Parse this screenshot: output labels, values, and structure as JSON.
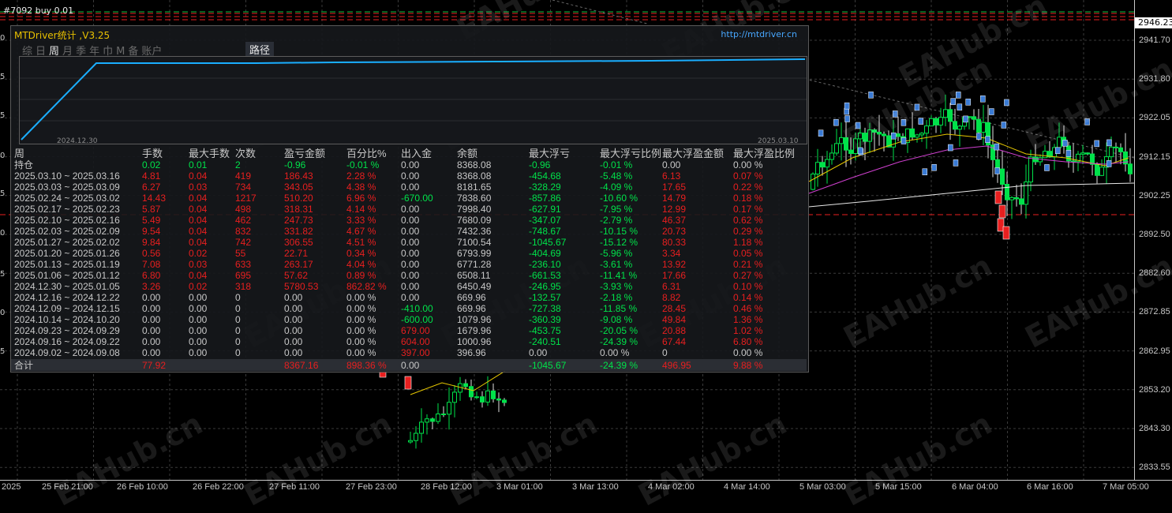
{
  "top_info": "#7092 buy 0.01",
  "panel": {
    "title": "MTDriver统计 ,V3.25",
    "url": "http://mtdriver.cn",
    "tabs": [
      "综",
      "日",
      "周",
      "月",
      "季",
      "年",
      "巾",
      "M",
      "备",
      "账户"
    ],
    "active_tab": "周",
    "path_button": "路径",
    "eq_dates": [
      "2024.12.30",
      "2025.03.10"
    ],
    "headers": [
      "周",
      "手数",
      "最大手数",
      "次数",
      "盈亏金额",
      "百分比%",
      "出入金",
      "余额",
      "最大浮亏",
      "最大浮亏比例",
      "最大浮盈金额",
      "最大浮盈比例"
    ],
    "rows": [
      {
        "c": [
          "持仓",
          "0.02",
          "0.01",
          "2",
          "-0.96",
          "-0.01 %",
          "0.00",
          "8368.08",
          "-0.96",
          "-0.01 %",
          "0.00",
          "0.00 %"
        ],
        "k": [
          "w",
          "g",
          "g",
          "g",
          "g",
          "g",
          "w",
          "w",
          "g",
          "g",
          "w",
          "w"
        ]
      },
      {
        "c": [
          "2025.03.10 ~ 2025.03.16",
          "4.81",
          "0.04",
          "419",
          "186.43",
          "2.28 %",
          "0.00",
          "8368.08",
          "-454.68",
          "-5.48 %",
          "6.13",
          "0.07 %"
        ],
        "k": [
          "w",
          "r",
          "r",
          "r",
          "r",
          "r",
          "w",
          "w",
          "g",
          "g",
          "r",
          "r"
        ]
      },
      {
        "c": [
          "2025.03.03 ~ 2025.03.09",
          "6.27",
          "0.03",
          "734",
          "343.05",
          "4.38 %",
          "0.00",
          "8181.65",
          "-328.29",
          "-4.09 %",
          "17.65",
          "0.22 %"
        ],
        "k": [
          "w",
          "r",
          "r",
          "r",
          "r",
          "r",
          "w",
          "w",
          "g",
          "g",
          "r",
          "r"
        ]
      },
      {
        "c": [
          "2025.02.24 ~ 2025.03.02",
          "14.43",
          "0.04",
          "1217",
          "510.20",
          "6.96 %",
          "-670.00",
          "7838.60",
          "-857.86",
          "-10.60 %",
          "14.79",
          "0.18 %"
        ],
        "k": [
          "w",
          "r",
          "r",
          "r",
          "r",
          "r",
          "g",
          "w",
          "g",
          "g",
          "r",
          "r"
        ]
      },
      {
        "c": [
          "2025.02.17 ~ 2025.02.23",
          "5.87",
          "0.04",
          "498",
          "318.31",
          "4.14 %",
          "0.00",
          "7998.40",
          "-627.91",
          "-7.95 %",
          "12.99",
          "0.17 %"
        ],
        "k": [
          "w",
          "r",
          "r",
          "r",
          "r",
          "r",
          "w",
          "w",
          "g",
          "g",
          "r",
          "r"
        ]
      },
      {
        "c": [
          "2025.02.10 ~ 2025.02.16",
          "5.49",
          "0.04",
          "462",
          "247.73",
          "3.33 %",
          "0.00",
          "7680.09",
          "-347.07",
          "-2.79 %",
          "46.37",
          "0.62 %"
        ],
        "k": [
          "w",
          "r",
          "r",
          "r",
          "r",
          "r",
          "w",
          "w",
          "g",
          "g",
          "r",
          "r"
        ]
      },
      {
        "c": [
          "2025.02.03 ~ 2025.02.09",
          "9.54",
          "0.04",
          "832",
          "331.82",
          "4.67 %",
          "0.00",
          "7432.36",
          "-748.67",
          "-10.15 %",
          "20.73",
          "0.29 %"
        ],
        "k": [
          "w",
          "r",
          "r",
          "r",
          "r",
          "r",
          "w",
          "w",
          "g",
          "g",
          "r",
          "r"
        ]
      },
      {
        "c": [
          "2025.01.27 ~ 2025.02.02",
          "9.84",
          "0.04",
          "742",
          "306.55",
          "4.51 %",
          "0.00",
          "7100.54",
          "-1045.67",
          "-15.12 %",
          "80.33",
          "1.18 %"
        ],
        "k": [
          "w",
          "r",
          "r",
          "r",
          "r",
          "r",
          "w",
          "w",
          "g",
          "g",
          "r",
          "r"
        ]
      },
      {
        "c": [
          "2025.01.20 ~ 2025.01.26",
          "0.56",
          "0.02",
          "55",
          "22.71",
          "0.34 %",
          "0.00",
          "6793.99",
          "-404.69",
          "-5.96 %",
          "3.34",
          "0.05 %"
        ],
        "k": [
          "w",
          "r",
          "r",
          "r",
          "r",
          "r",
          "w",
          "w",
          "g",
          "g",
          "r",
          "r"
        ]
      },
      {
        "c": [
          "2025.01.13 ~ 2025.01.19",
          "7.08",
          "0.03",
          "633",
          "263.17",
          "4.04 %",
          "0.00",
          "6771.28",
          "-236.10",
          "-3.61 %",
          "13.92",
          "0.21 %"
        ],
        "k": [
          "w",
          "r",
          "r",
          "r",
          "r",
          "r",
          "w",
          "w",
          "g",
          "g",
          "r",
          "r"
        ]
      },
      {
        "c": [
          "2025.01.06 ~ 2025.01.12",
          "6.80",
          "0.04",
          "695",
          "57.62",
          "0.89 %",
          "0.00",
          "6508.11",
          "-661.53",
          "-11.41 %",
          "17.66",
          "0.27 %"
        ],
        "k": [
          "w",
          "r",
          "r",
          "r",
          "r",
          "r",
          "w",
          "w",
          "g",
          "g",
          "r",
          "r"
        ]
      },
      {
        "c": [
          "2024.12.30 ~ 2025.01.05",
          "3.26",
          "0.02",
          "318",
          "5780.53",
          "862.82 %",
          "0.00",
          "6450.49",
          "-246.95",
          "-3.93 %",
          "6.31",
          "0.10 %"
        ],
        "k": [
          "w",
          "r",
          "r",
          "r",
          "r",
          "r",
          "w",
          "w",
          "g",
          "g",
          "r",
          "r"
        ]
      },
      {
        "c": [
          "2024.12.16 ~ 2024.12.22",
          "0.00",
          "0.00",
          "0",
          "0.00",
          "0.00 %",
          "0.00",
          "669.96",
          "-132.57",
          "-2.18 %",
          "8.82",
          "0.14 %"
        ],
        "k": [
          "w",
          "w",
          "w",
          "w",
          "w",
          "w",
          "w",
          "w",
          "g",
          "g",
          "r",
          "r"
        ]
      },
      {
        "c": [
          "2024.12.09 ~ 2024.12.15",
          "0.00",
          "0.00",
          "0",
          "0.00",
          "0.00 %",
          "-410.00",
          "669.96",
          "-727.38",
          "-11.85 %",
          "28.45",
          "0.46 %"
        ],
        "k": [
          "w",
          "w",
          "w",
          "w",
          "w",
          "w",
          "g",
          "w",
          "g",
          "g",
          "r",
          "r"
        ]
      },
      {
        "c": [
          "2024.10.14 ~ 2024.10.20",
          "0.00",
          "0.00",
          "0",
          "0.00",
          "0.00 %",
          "-600.00",
          "1079.96",
          "-360.39",
          "-9.08 %",
          "49.84",
          "1.36 %"
        ],
        "k": [
          "w",
          "w",
          "w",
          "w",
          "w",
          "w",
          "g",
          "w",
          "g",
          "g",
          "r",
          "r"
        ]
      },
      {
        "c": [
          "2024.09.23 ~ 2024.09.29",
          "0.00",
          "0.00",
          "0",
          "0.00",
          "0.00 %",
          "679.00",
          "1679.96",
          "-453.75",
          "-20.05 %",
          "20.88",
          "1.02 %"
        ],
        "k": [
          "w",
          "w",
          "w",
          "w",
          "w",
          "w",
          "r",
          "w",
          "g",
          "g",
          "r",
          "r"
        ]
      },
      {
        "c": [
          "2024.09.16 ~ 2024.09.22",
          "0.00",
          "0.00",
          "0",
          "0.00",
          "0.00 %",
          "604.00",
          "1000.96",
          "-240.51",
          "-24.39 %",
          "67.44",
          "6.80 %"
        ],
        "k": [
          "w",
          "w",
          "w",
          "w",
          "w",
          "w",
          "r",
          "w",
          "g",
          "g",
          "r",
          "r"
        ]
      },
      {
        "c": [
          "2024.09.02 ~ 2024.09.08",
          "0.00",
          "0.00",
          "0",
          "0.00",
          "0.00 %",
          "397.00",
          "396.96",
          "0.00",
          "0.00 %",
          "0",
          "0.00 %"
        ],
        "k": [
          "w",
          "w",
          "w",
          "w",
          "w",
          "w",
          "r",
          "w",
          "w",
          "w",
          "w",
          "w"
        ]
      }
    ],
    "total": {
      "c": [
        "合计",
        "77.92",
        "",
        "",
        "8367.16",
        "898.36 %",
        "0.00",
        "",
        "-1045.67",
        "-24.39 %",
        "496.95",
        "9.88 %"
      ],
      "k": [
        "w",
        "r",
        "w",
        "w",
        "r",
        "r",
        "w",
        "w",
        "g",
        "g",
        "r",
        "r"
      ]
    }
  },
  "price_axis": [
    "2941.70",
    "2931.80",
    "2922.05",
    "2912.15",
    "2902.25",
    "2892.50",
    "2882.60",
    "2872.85",
    "2862.95",
    "2853.20",
    "2843.30",
    "2833.55"
  ],
  "current_price": "2946.23",
  "time_axis": [
    "2025",
    "25 Feb 21:00",
    "26 Feb 10:00",
    "26 Feb 22:00",
    "27 Feb 11:00",
    "27 Feb 23:00",
    "28 Feb 12:00",
    "3 Mar 01:00",
    "3 Mar 13:00",
    "4 Mar 02:00",
    "4 Mar 14:00",
    "5 Mar 03:00",
    "5 Mar 15:00",
    "6 Mar 04:00",
    "6 Mar 16:00",
    "7 Mar 05:00"
  ],
  "left_edge_labels": [
    "0",
    "5",
    "5",
    "0",
    "5",
    "0",
    "5",
    "0",
    "5"
  ],
  "watermark": "EAHub.cn",
  "colors": {
    "title": "#e8c000",
    "url": "#47a7ff",
    "profit": "#e81f1f",
    "loss": "#00e24a",
    "equity_line": "#1aaeff"
  }
}
